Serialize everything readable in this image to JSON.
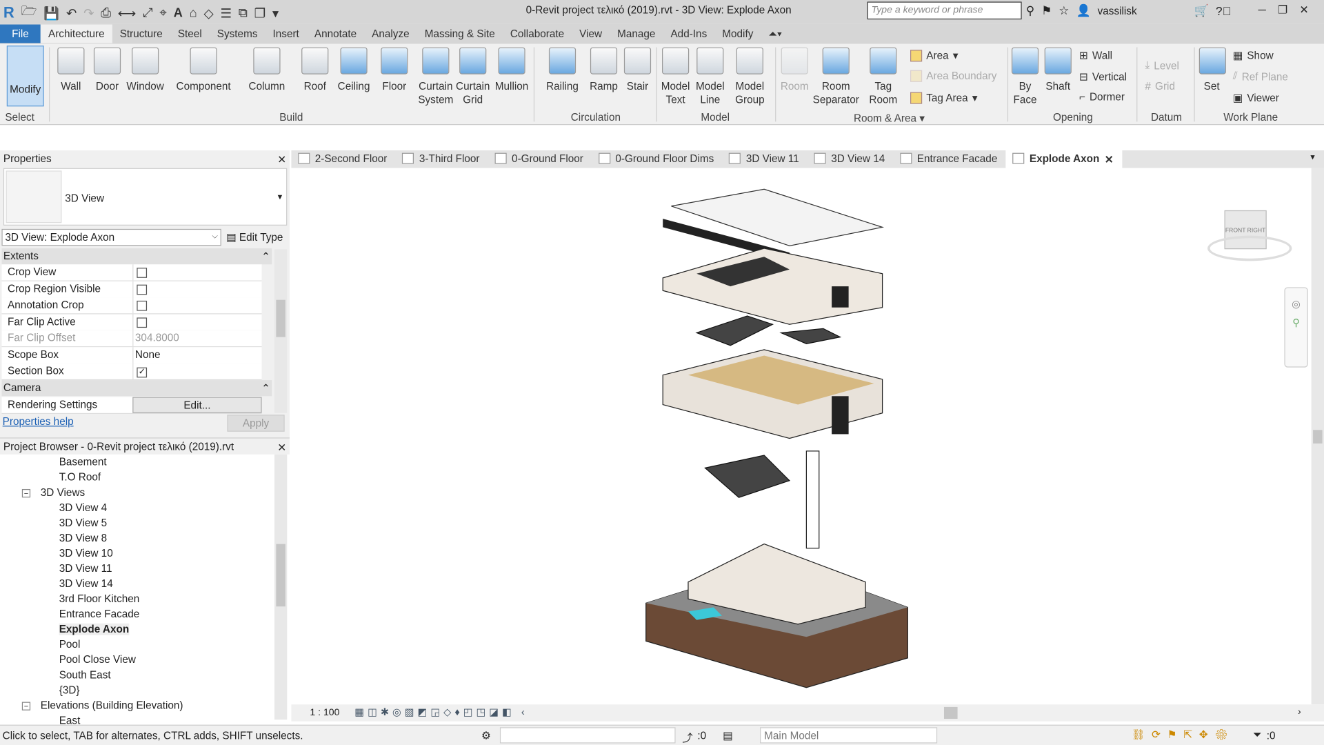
{
  "app": {
    "title": "0-Revit project τελικό (2019).rvt - 3D View: Explode Axon",
    "search_placeholder": "Type a keyword or phrase",
    "user": "vassilisk"
  },
  "ribbon_tabs": [
    "File",
    "Architecture",
    "Structure",
    "Steel",
    "Systems",
    "Insert",
    "Annotate",
    "Analyze",
    "Massing & Site",
    "Collaborate",
    "View",
    "Manage",
    "Add-Ins",
    "Modify"
  ],
  "active_tab": "Architecture",
  "ribbon": {
    "select": {
      "modify": "Modify",
      "select": "Select"
    },
    "build": {
      "label": "Build",
      "buttons": [
        "Wall",
        "Door",
        "Window",
        "Component",
        "Column",
        "Roof",
        "Ceiling",
        "Floor",
        "Curtain System",
        "Curtain Grid",
        "Mullion"
      ]
    },
    "circulation": {
      "label": "Circulation",
      "buttons": [
        "Railing",
        "Ramp",
        "Stair"
      ]
    },
    "model": {
      "label": "Model",
      "buttons": [
        "Model Text",
        "Model Line",
        "Model Group"
      ]
    },
    "room_area": {
      "label": "Room & Area",
      "buttons": [
        "Room",
        "Room Separator",
        "Tag Room"
      ],
      "small": [
        "Area",
        "Area  Boundary",
        "Tag  Area"
      ]
    },
    "opening": {
      "label": "Opening",
      "buttons": [
        "By Face",
        "Shaft"
      ],
      "small": [
        "Wall",
        "Vertical",
        "Dormer"
      ]
    },
    "datum": {
      "label": "Datum",
      "small": [
        "Level",
        "Grid"
      ]
    },
    "work_plane": {
      "label": "Work Plane",
      "set": "Set",
      "small": [
        "Show",
        "Ref  Plane",
        "Viewer"
      ]
    }
  },
  "view_tabs": [
    {
      "label": "2-Second Floor"
    },
    {
      "label": "3-Third Floor"
    },
    {
      "label": "0-Ground Floor"
    },
    {
      "label": "0-Ground Floor Dims"
    },
    {
      "label": "3D View 11"
    },
    {
      "label": "3D View 14"
    },
    {
      "label": "Entrance Facade"
    },
    {
      "label": "Explode Axon",
      "active": true
    }
  ],
  "properties": {
    "title": "Properties",
    "type_name": "3D View",
    "instance": "3D View: Explode Axon",
    "edit_type": "Edit Type",
    "categories": {
      "extents": "Extents",
      "camera": "Camera"
    },
    "rows": [
      {
        "key": "Crop View",
        "checked": false
      },
      {
        "key": "Crop Region Visible",
        "checked": false
      },
      {
        "key": "Annotation Crop",
        "checked": false
      },
      {
        "key": "Far Clip Active",
        "checked": false
      },
      {
        "key": "Far Clip Offset",
        "value": "304.8000"
      },
      {
        "key": "Scope Box",
        "value": "None"
      },
      {
        "key": "Section Box",
        "checked": true
      }
    ],
    "rendering": {
      "key": "Rendering Settings",
      "value": "Edit..."
    },
    "help": "Properties help",
    "apply": "Apply"
  },
  "project_browser": {
    "title": "Project Browser - 0-Revit project τελικό (2019).rvt",
    "items": [
      {
        "label": "Basement",
        "level": 2
      },
      {
        "label": "T.O Roof",
        "level": 2
      },
      {
        "label": "3D Views",
        "level": 1,
        "expanded": true
      },
      {
        "label": "3D View 4",
        "level": 2
      },
      {
        "label": "3D View 5",
        "level": 2
      },
      {
        "label": "3D View 8",
        "level": 2
      },
      {
        "label": "3D View 10",
        "level": 2
      },
      {
        "label": "3D View 11",
        "level": 2
      },
      {
        "label": "3D View 14",
        "level": 2
      },
      {
        "label": "3rd Floor Kitchen",
        "level": 2
      },
      {
        "label": "Entrance Facade",
        "level": 2
      },
      {
        "label": "Explode Axon",
        "level": 2,
        "selected": true
      },
      {
        "label": "Pool",
        "level": 2
      },
      {
        "label": "Pool Close View",
        "level": 2
      },
      {
        "label": "South East",
        "level": 2
      },
      {
        "label": "{3D}",
        "level": 2
      },
      {
        "label": "Elevations (Building Elevation)",
        "level": 1,
        "expanded": true
      },
      {
        "label": "East",
        "level": 2
      }
    ]
  },
  "view_cube": {
    "front": "FRONT",
    "right": "RIGHT"
  },
  "view_control": {
    "scale": "1 : 100"
  },
  "status": {
    "message": "Click to select, TAB for alternates, CTRL adds, SHIFT unselects.",
    "workset_count": ":0",
    "model": "Main Model",
    "filter_count": ":0"
  },
  "colors": {
    "file_tab": "#2f77bf",
    "selected_tool": "#c6def5"
  }
}
